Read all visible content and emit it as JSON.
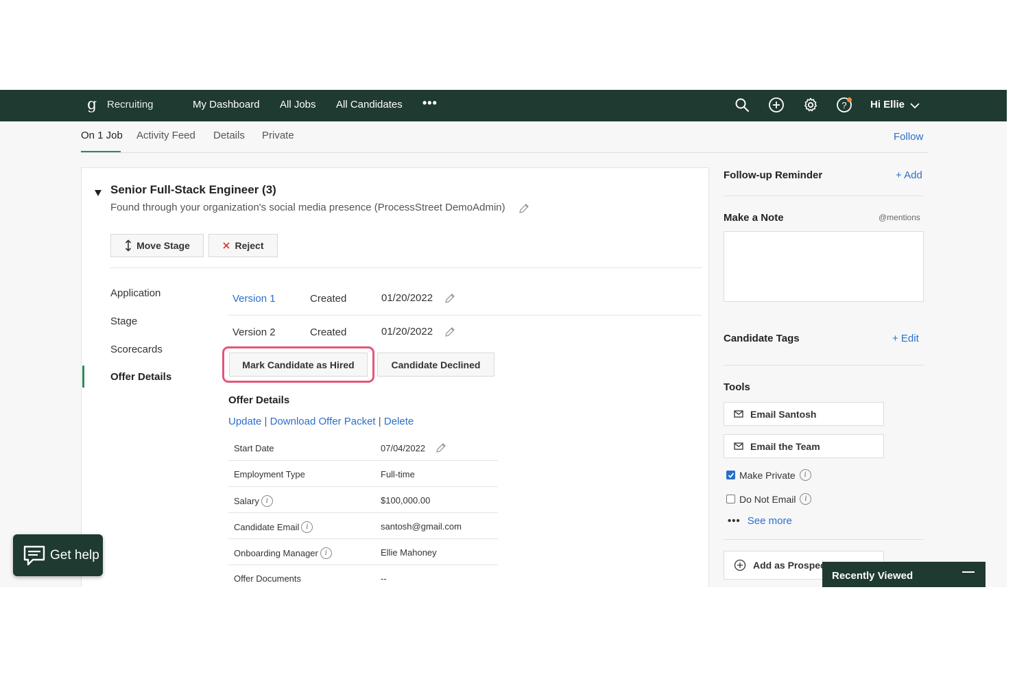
{
  "topnav": {
    "brand": "Recruiting",
    "logo_glyph": "g",
    "links": [
      "My Dashboard",
      "All Jobs",
      "All Candidates"
    ],
    "more": "•••",
    "greeting": "Hi Ellie",
    "icons": [
      "search-icon",
      "add-circle-icon",
      "gear-icon",
      "help-icon",
      "chevron-down-icon"
    ],
    "colors": {
      "bar": "#1f3a30",
      "notify_dot": "#f0894a"
    }
  },
  "subtabs": {
    "items": [
      "On 1 Job",
      "Activity Feed",
      "Details",
      "Private"
    ],
    "active": "On 1 Job",
    "follow": "Follow"
  },
  "job": {
    "title": "Senior Full-Stack Engineer (3)",
    "source": "Found through your organization's social media presence (ProcessStreet DemoAdmin)",
    "move_stage": "Move Stage",
    "reject": "Reject"
  },
  "sidenav": {
    "items": [
      "Application",
      "Stage",
      "Scorecards",
      "Offer Details"
    ],
    "active": "Offer Details"
  },
  "versions": [
    {
      "label": "Version 1",
      "status": "Created",
      "date": "01/20/2022"
    },
    {
      "label": "Version 2",
      "status": "Created",
      "date": "01/20/2022"
    }
  ],
  "actions": {
    "mark_hired": "Mark Candidate as Hired",
    "declined": "Candidate Declined"
  },
  "offer": {
    "heading": "Offer Details",
    "link_update": "Update",
    "link_download": "Download Offer Packet",
    "link_delete": "Delete",
    "separator": "|",
    "rows": [
      {
        "key": "Start Date",
        "value": "07/04/2022"
      },
      {
        "key": "Employment Type",
        "value": "Full-time"
      },
      {
        "key": "Salary",
        "value": "$100,000.00"
      },
      {
        "key": "Candidate Email",
        "value": "santosh@gmail.com"
      },
      {
        "key": "Onboarding Manager",
        "value": "Ellie Mahoney"
      },
      {
        "key": "Offer Documents",
        "value": "--"
      }
    ]
  },
  "right": {
    "reminder_title": "Follow-up Reminder",
    "reminder_add": "+ Add",
    "note_title": "Make a Note",
    "mentions": "@mentions",
    "tags_title": "Candidate Tags",
    "tags_edit": "+ Edit",
    "tools_title": "Tools",
    "email_candidate": "Email Santosh",
    "email_team": "Email the Team",
    "make_private": "Make Private",
    "make_private_checked": true,
    "do_not_email": "Do Not Email",
    "do_not_email_checked": false,
    "see_more_dots": "•••",
    "see_more": "See more",
    "add_prospect": "Add as Prospect",
    "recently_viewed": "Recently Viewed"
  },
  "help": {
    "label": "Get help"
  },
  "info_glyph": "i"
}
